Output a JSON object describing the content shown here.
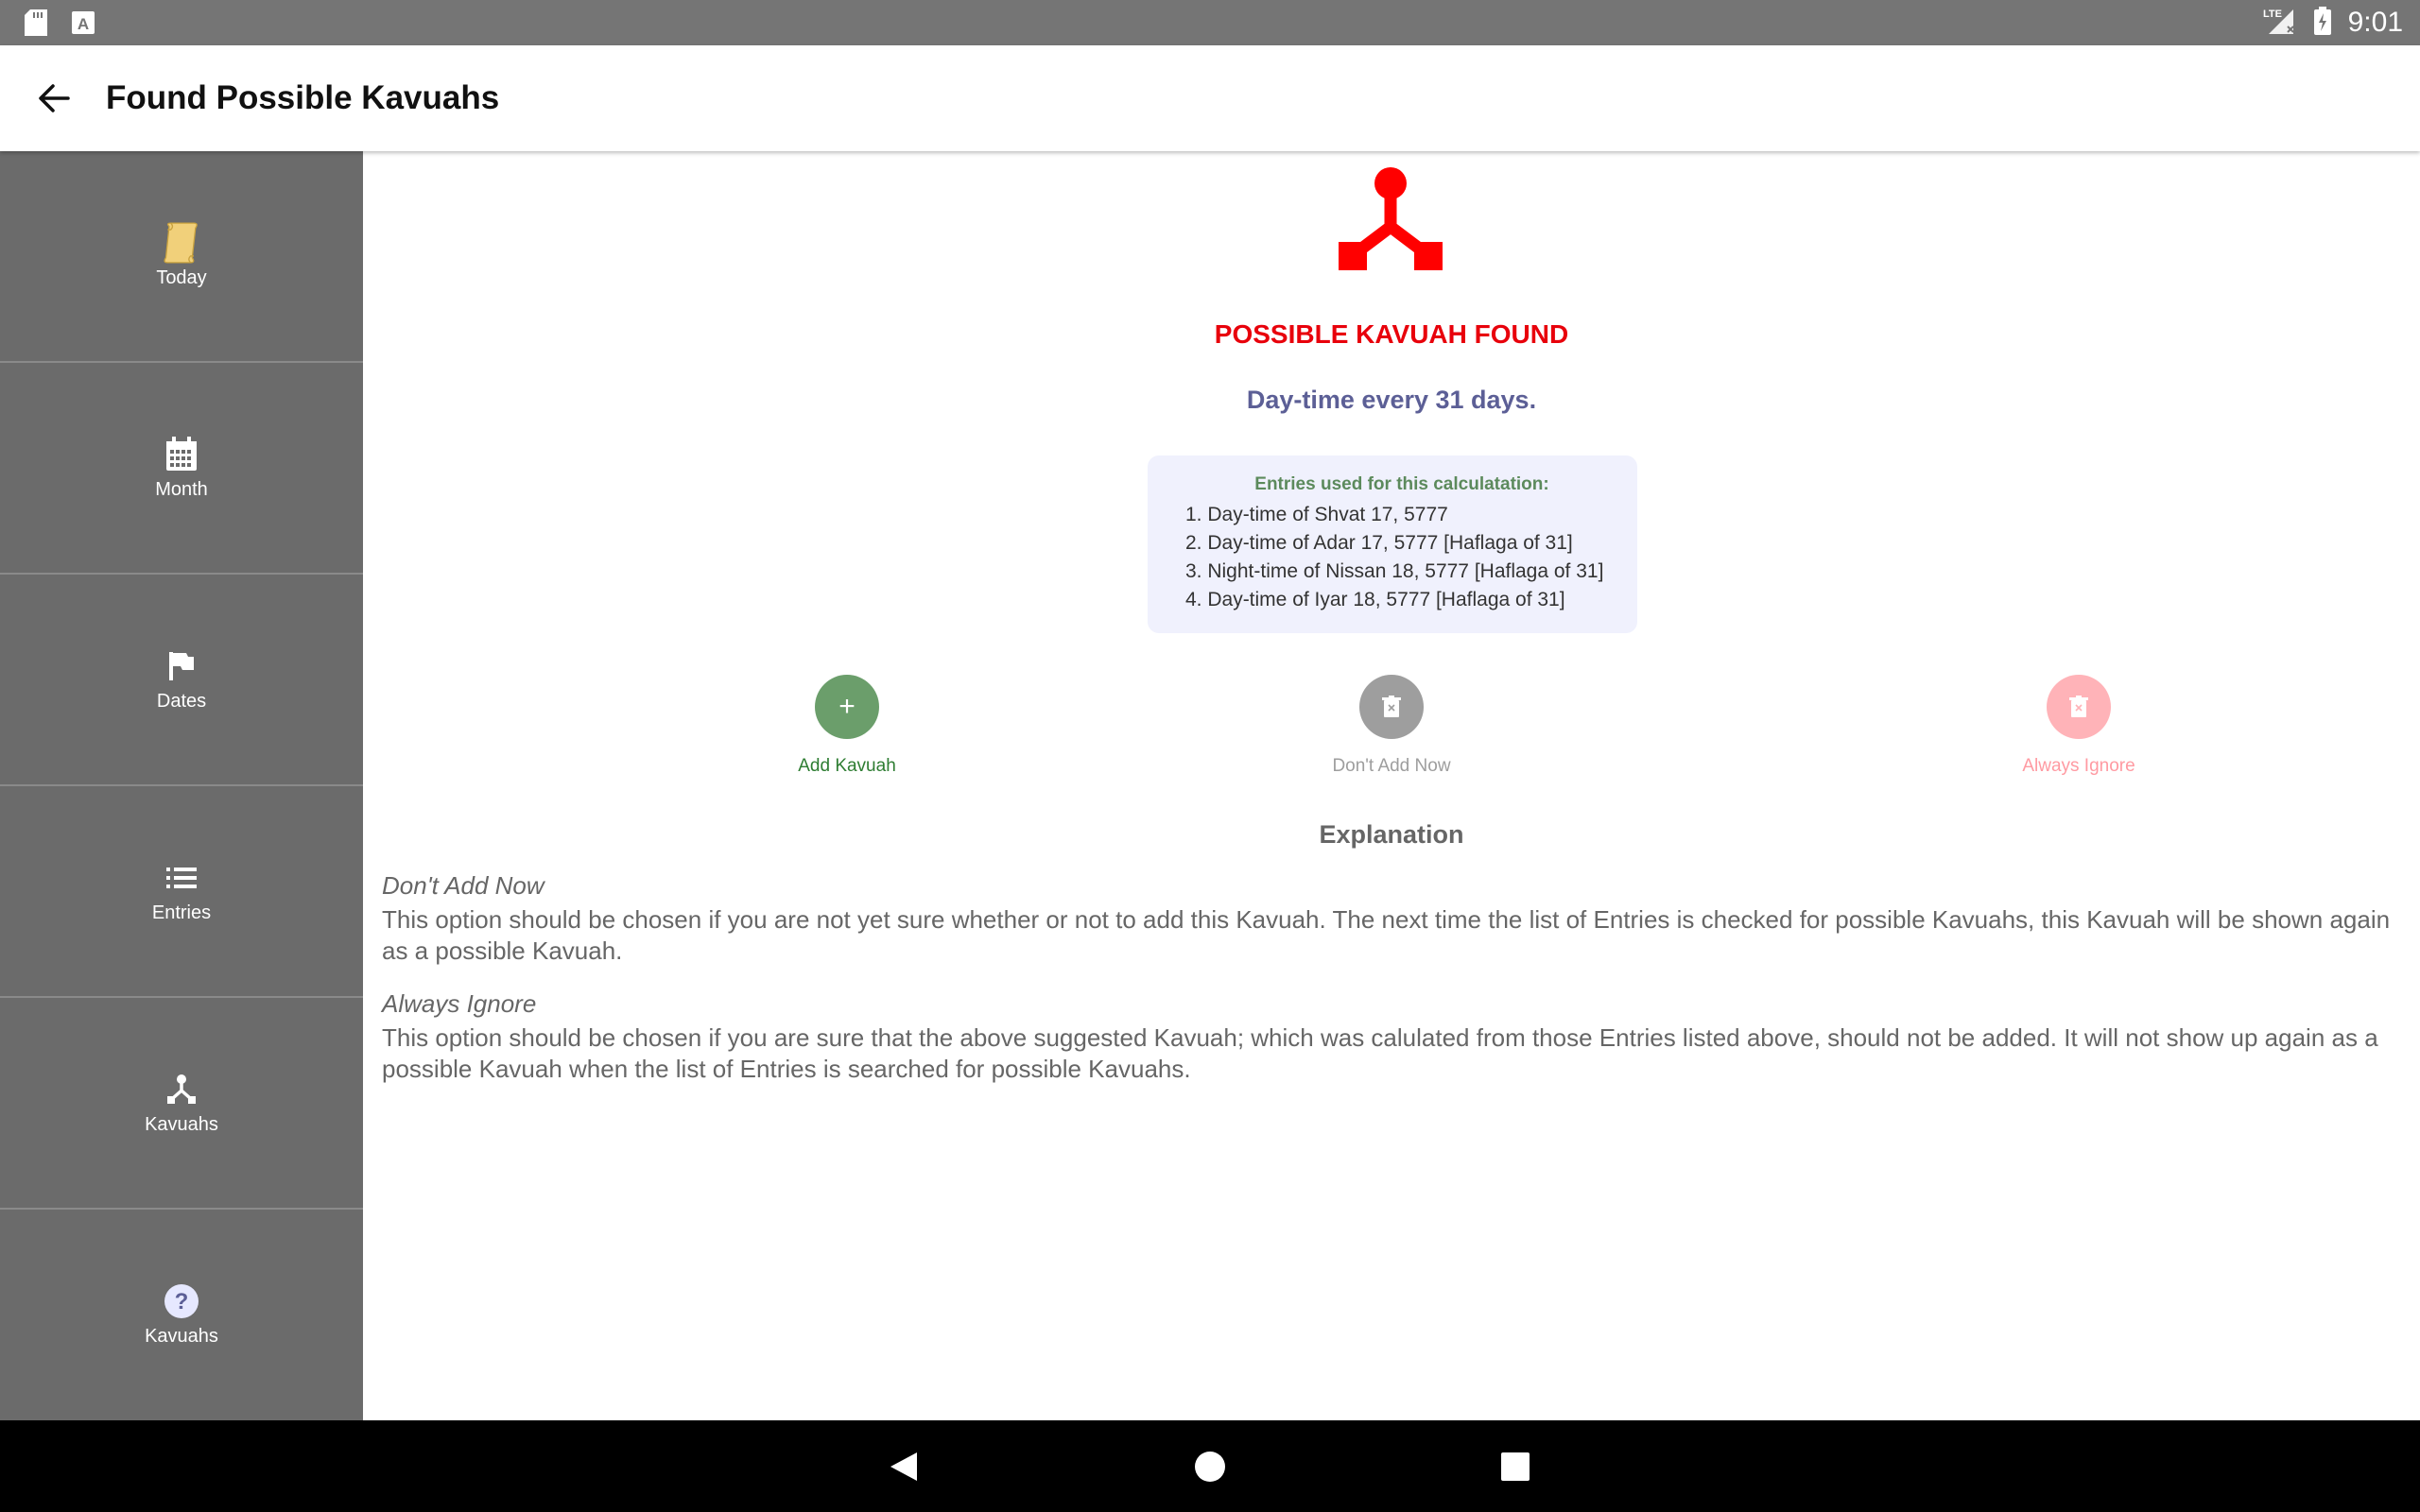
{
  "status_bar": {
    "time": "9:01",
    "network": "LTE"
  },
  "app_bar": {
    "title": "Found Possible Kavuahs"
  },
  "sidebar": {
    "items": [
      {
        "label": "Today",
        "icon": "scroll-icon"
      },
      {
        "label": "Month",
        "icon": "calendar-icon"
      },
      {
        "label": "Dates",
        "icon": "flag-icon"
      },
      {
        "label": "Entries",
        "icon": "list-icon"
      },
      {
        "label": "Kavuahs",
        "icon": "kavuah-icon"
      },
      {
        "label": "Kavuahs",
        "icon": "help-icon"
      }
    ]
  },
  "main": {
    "heading": "POSSIBLE KAVUAH FOUND",
    "description": "Day-time every 31 days.",
    "entries_box": {
      "heading": "Entries used for this calculatation:",
      "items": [
        "1. Day-time of Shvat 17, 5777",
        "2. Day-time of Adar 17, 5777 [Haflaga of 31]",
        "3. Night-time of Nissan 18, 5777 [Haflaga of 31]",
        "4. Day-time of Iyar 18, 5777 [Haflaga of 31]"
      ]
    },
    "actions": {
      "add": {
        "label": "Add Kavuah",
        "symbol": "+"
      },
      "dont_add": {
        "label": "Don't Add Now"
      },
      "ignore": {
        "label": "Always Ignore"
      }
    },
    "explanation": {
      "heading": "Explanation",
      "dont_add_title": "Don't Add Now",
      "dont_add_text": "This option should be chosen if you are not yet sure whether or not to add this Kavuah. The next time the list of Entries is checked for possible Kavuahs, this Kavuah will be shown again as a possible Kavuah.",
      "ignore_title": "Always Ignore",
      "ignore_text": "This option should be chosen if you are sure that the above suggested Kavuah; which was calulated from those Entries listed above, should not be added. It will not show up again as a possible Kavuah when the list of Entries is searched for possible Kavuahs."
    }
  },
  "colors": {
    "accent_red": "#e8000b",
    "subtitle": "#5c5f96",
    "add_green": "#6b9e6b",
    "dont_add_gray": "#9e9e9e",
    "ignore_pink": "#ffb3b8",
    "sidebar_bg": "#6b6b6b",
    "status_bar_bg": "#757575"
  }
}
